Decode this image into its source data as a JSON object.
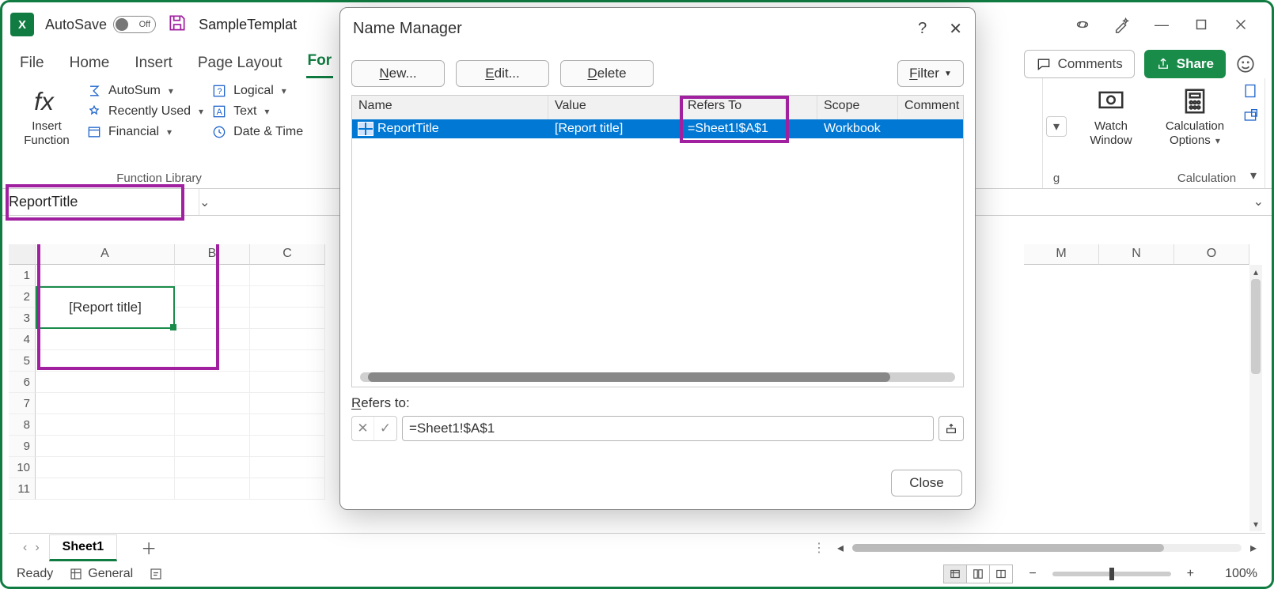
{
  "titlebar": {
    "autosave_label": "AutoSave",
    "autosave_state": "Off",
    "filename": "SampleTemplat"
  },
  "window_buttons": {
    "min": "—",
    "max": "▢",
    "close": "✕"
  },
  "tabs": {
    "file": "File",
    "home": "Home",
    "insert": "Insert",
    "page_layout": "Page Layout",
    "formulas_prefix": "For"
  },
  "ribbon_right": {
    "comments": "Comments",
    "share": "Share"
  },
  "ribbon": {
    "insert_function": "Insert\nFunction",
    "autosum": "AutoSum",
    "recently": "Recently Used",
    "financial": "Financial",
    "logical": "Logical",
    "text": "Text",
    "datetime": "Date & Time",
    "library_caption": "Function Library",
    "watch": "Watch\nWindow",
    "calc_options": "Calculation\nOptions",
    "calc_caption": "Calculation",
    "letter_g": "g"
  },
  "namebox": "ReportTitle",
  "grid": {
    "cols": [
      "A",
      "B",
      "C"
    ],
    "cols_right": [
      "M",
      "N",
      "O"
    ],
    "rows": [
      "1",
      "2",
      "3",
      "4",
      "5",
      "6",
      "7",
      "8",
      "9",
      "10",
      "11"
    ],
    "cellA1": "[Report title]"
  },
  "sheet": {
    "name": "Sheet1"
  },
  "statusbar": {
    "ready": "Ready",
    "general": "General",
    "zoom": "100%"
  },
  "zoom": {
    "minus": "−",
    "plus": "+"
  },
  "dialog": {
    "title": "Name Manager",
    "help": "?",
    "new": "New...",
    "new_u": "N",
    "edit": "Edit...",
    "edit_u": "E",
    "delete": "elete",
    "delete_u": "D",
    "filter": "ilter",
    "filter_u": "F",
    "cols": {
      "name": "Name",
      "value": "Value",
      "refers": "Refers To",
      "scope": "Scope",
      "comment": "Comment"
    },
    "row": {
      "name": "ReportTitle",
      "value": "[Report title]",
      "refers": "=Sheet1!$A$1",
      "scope": "Workbook",
      "comment": ""
    },
    "refers_label_pre": "R",
    "refers_label": "efers to:",
    "refers_value": "=Sheet1!$A$1",
    "close": "Close"
  }
}
